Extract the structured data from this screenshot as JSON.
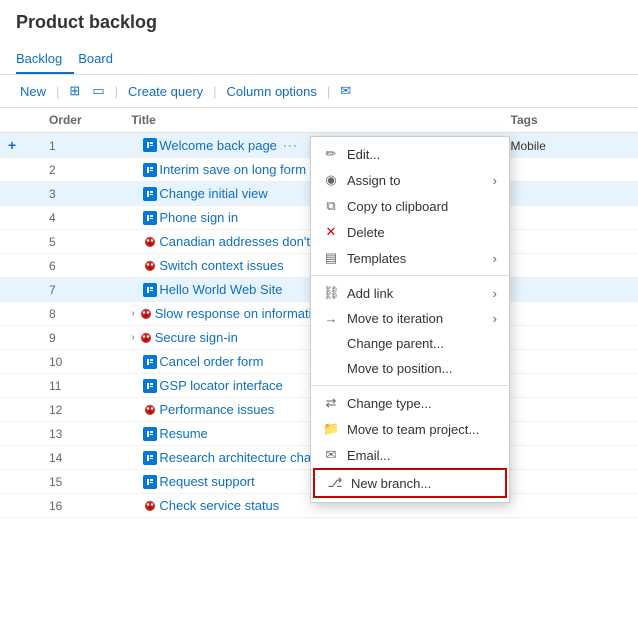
{
  "page": {
    "title": "Product backlog"
  },
  "tabs": [
    {
      "id": "backlog",
      "label": "Backlog",
      "active": true
    },
    {
      "id": "board",
      "label": "Board",
      "active": false
    }
  ],
  "toolbar": {
    "new_label": "New",
    "create_query_label": "Create query",
    "column_options_label": "Column options"
  },
  "table": {
    "headers": [
      "",
      "Order",
      "Title",
      "Tags"
    ],
    "rows": [
      {
        "order": "1",
        "type": "story",
        "title": "Welcome back page",
        "tags": "Mobile",
        "selected": true,
        "expanded": false,
        "show_dots": true
      },
      {
        "order": "2",
        "type": "story",
        "title": "Interim save on long form",
        "tags": "",
        "selected": false
      },
      {
        "order": "3",
        "type": "story",
        "title": "Change initial view",
        "tags": "",
        "selected": false,
        "highlighted": true
      },
      {
        "order": "4",
        "type": "story",
        "title": "Phone sign in",
        "tags": "",
        "selected": false
      },
      {
        "order": "5",
        "type": "bug",
        "title": "Canadian addresses don't disp",
        "tags": "",
        "selected": false
      },
      {
        "order": "6",
        "type": "bug",
        "title": "Switch context issues",
        "tags": "",
        "selected": false
      },
      {
        "order": "7",
        "type": "story",
        "title": "Hello World Web Site",
        "tags": "",
        "selected": false,
        "highlighted": true
      },
      {
        "order": "8",
        "type": "bug",
        "title": "Slow response on information",
        "tags": "",
        "selected": false,
        "expanded": true
      },
      {
        "order": "9",
        "type": "bug",
        "title": "Secure sign-in",
        "tags": "",
        "selected": false,
        "expanded": true
      },
      {
        "order": "10",
        "type": "story",
        "title": "Cancel order form",
        "tags": "",
        "selected": false
      },
      {
        "order": "11",
        "type": "story",
        "title": "GSP locator interface",
        "tags": "",
        "selected": false
      },
      {
        "order": "12",
        "type": "bug",
        "title": "Performance issues",
        "tags": "",
        "selected": false
      },
      {
        "order": "13",
        "type": "story",
        "title": "Resume",
        "tags": "",
        "selected": false
      },
      {
        "order": "14",
        "type": "story",
        "title": "Research architecture changes",
        "tags": "",
        "selected": false
      },
      {
        "order": "15",
        "type": "story",
        "title": "Request support",
        "tags": "",
        "selected": false
      },
      {
        "order": "16",
        "type": "bug",
        "title": "Check service status",
        "tags": "",
        "selected": false
      }
    ]
  },
  "context_menu": {
    "items": [
      {
        "id": "edit",
        "label": "Edit...",
        "icon": "✏",
        "has_arrow": false
      },
      {
        "id": "assign-to",
        "label": "Assign to",
        "icon": "👤",
        "has_arrow": true
      },
      {
        "id": "copy-clipboard",
        "label": "Copy to clipboard",
        "icon": "📋",
        "has_arrow": false
      },
      {
        "id": "delete",
        "label": "Delete",
        "icon": "✕",
        "has_arrow": false,
        "red": true
      },
      {
        "id": "templates",
        "label": "Templates",
        "icon": "▤",
        "has_arrow": true
      },
      {
        "id": "add-link",
        "label": "Add link",
        "icon": "🔗",
        "has_arrow": true
      },
      {
        "id": "move-iteration",
        "label": "Move to iteration",
        "icon": "→",
        "has_arrow": true
      },
      {
        "id": "change-parent",
        "label": "Change parent...",
        "icon": "",
        "has_arrow": false
      },
      {
        "id": "move-position",
        "label": "Move to position...",
        "icon": "",
        "has_arrow": false
      },
      {
        "id": "change-type",
        "label": "Change type...",
        "icon": "⇄",
        "has_arrow": false
      },
      {
        "id": "move-team",
        "label": "Move to team project...",
        "icon": "📁",
        "has_arrow": false
      },
      {
        "id": "email",
        "label": "Email...",
        "icon": "✉",
        "has_arrow": false
      },
      {
        "id": "new-branch",
        "label": "New branch...",
        "icon": "⑂",
        "has_arrow": false,
        "highlighted": true
      }
    ]
  }
}
